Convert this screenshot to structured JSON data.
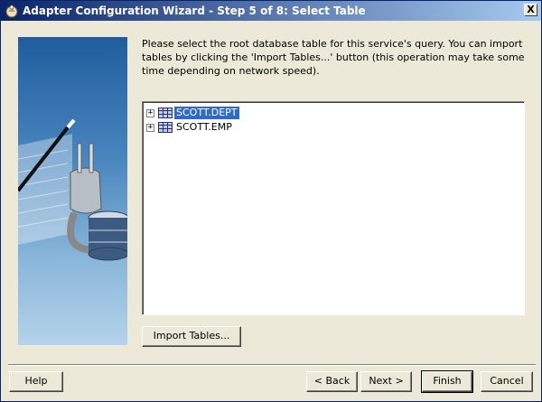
{
  "window": {
    "title": "Adapter Configuration Wizard - Step 5 of 8: Select Table",
    "close_label": "X",
    "title_icon": "wizard-app-icon"
  },
  "content": {
    "instructions": "Please select the root database table for this service's query.  You can import tables by clicking the 'Import Tables...' button (this operation may take some time depending on network speed).",
    "tree": {
      "items": [
        {
          "label": "SCOTT.DEPT",
          "expander": "+",
          "selected": true,
          "icon": "table-icon"
        },
        {
          "label": "SCOTT.EMP",
          "expander": "+",
          "selected": false,
          "icon": "table-icon"
        }
      ]
    },
    "import_button": "Import Tables..."
  },
  "footer": {
    "help_label": "Help",
    "back_label": "< Back",
    "next_label": "Next >",
    "finish_label": "Finish",
    "cancel_label": "Cancel"
  },
  "colors": {
    "title_gradient_start": "#0a246a",
    "title_gradient_end": "#a6caf0",
    "selection": "#316ac5",
    "dialog_bg": "#ece9d8"
  }
}
